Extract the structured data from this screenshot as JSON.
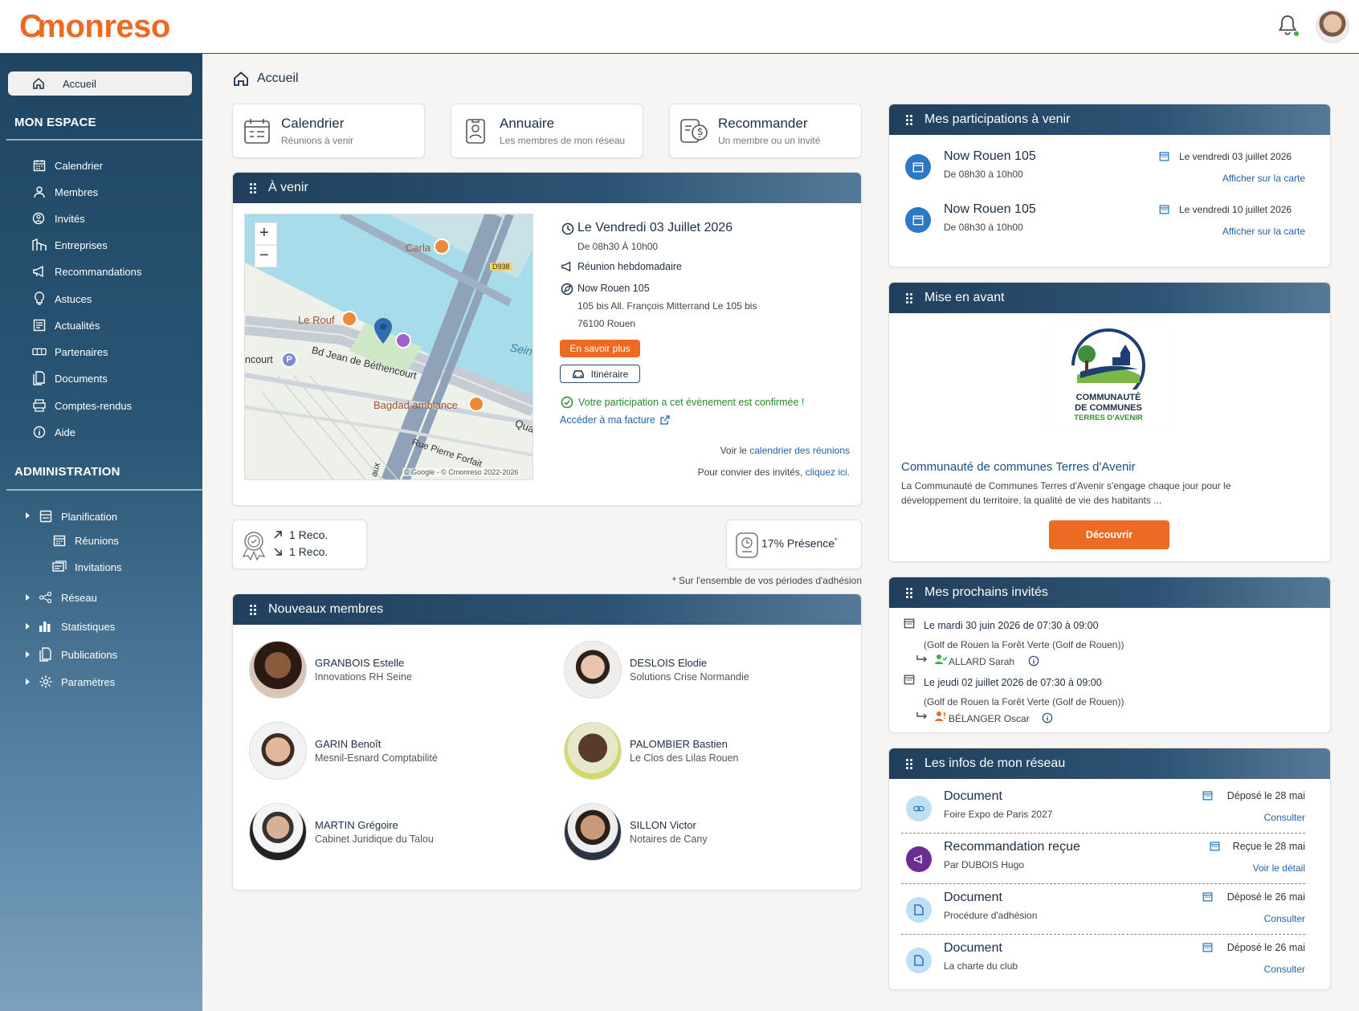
{
  "app": {
    "logo_part1": "C",
    "logo_part2": "monreso"
  },
  "sidebar": {
    "home": "Accueil",
    "section1": "MON ESPACE",
    "items": [
      {
        "label": "Calendrier",
        "icon": "calendar-icon"
      },
      {
        "label": "Membres",
        "icon": "members-icon"
      },
      {
        "label": "Invités",
        "icon": "guests-icon"
      },
      {
        "label": "Entreprises",
        "icon": "companies-icon"
      },
      {
        "label": "Recommandations",
        "icon": "megaphone-icon"
      },
      {
        "label": "Astuces",
        "icon": "lightbulb-icon"
      },
      {
        "label": "Actualités",
        "icon": "news-icon"
      },
      {
        "label": "Partenaires",
        "icon": "handshake-icon"
      },
      {
        "label": "Documents",
        "icon": "documents-icon"
      },
      {
        "label": "Comptes-rendus",
        "icon": "reports-icon"
      },
      {
        "label": "Aide",
        "icon": "info-icon"
      }
    ],
    "section2": "ADMINISTRATION",
    "admin": {
      "planification": "Planification",
      "reunions": "Réunions",
      "invitations": "Invitations",
      "reseau": "Réseau",
      "statistiques": "Statistiques",
      "publications": "Publications",
      "parametres": "Paramètres"
    }
  },
  "breadcrumb": "Accueil",
  "quick": [
    {
      "title": "Calendrier",
      "sub": "Réunions à venir"
    },
    {
      "title": "Annuaire",
      "sub": "Les membres de mon réseau"
    },
    {
      "title": "Recommander",
      "sub": "Un membre ou un invité"
    }
  ],
  "avenir": {
    "title": "À venir",
    "date": "Le Vendredi 03 Juillet 2026",
    "time": "De 08h30 À 10h00",
    "type": "Réunion hebdomadaire",
    "place": "Now Rouen 105",
    "address1": "105 bis All. François Mitterrand Le 105 bis",
    "address2": "76100 Rouen",
    "btn_more": "En savoir plus",
    "btn_route": "Itinéraire",
    "confirmed": "Votre participation a cet évènement est confirmée !",
    "invoice": "Accéder à ma facture",
    "see_prefix": "Voir le ",
    "see_link": "calendrier des réunions",
    "invite_prefix": "Pour convier des invités, ",
    "invite_link": "cliquez ici.",
    "map": {
      "zoom_in": "+",
      "zoom_out": "−",
      "labels": [
        "Carla",
        "Le Rouf",
        "Bd Jean de Béthencourt",
        "ncourt",
        "Bagdad ambiance",
        "Rue Pierre Forfait",
        "Sein",
        "Qua",
        "D938",
        "aux",
        "© Google - © Cmonreso 2022-2026"
      ]
    }
  },
  "stats": {
    "reco_out": "1 Reco.",
    "reco_in": "1 Reco.",
    "presence": "17% Présence",
    "presence_star": "*",
    "note": "* Sur l'ensemble de vos périodes d'adhésion"
  },
  "new_members": {
    "title": "Nouveaux membres",
    "list": [
      {
        "name": "GRANBOIS Estelle",
        "company": "Innovations RH Seine"
      },
      {
        "name": "DESLOIS Elodie",
        "company": "Solutions Crise Normandie"
      },
      {
        "name": "GARIN Benoît",
        "company": "Mesnil-Esnard Comptabilité"
      },
      {
        "name": "PALOMBIER Bastien",
        "company": "Le Clos des Lilas Rouen"
      },
      {
        "name": "MARTIN Grégoire",
        "company": "Cabinet Juridique du Talou"
      },
      {
        "name": "SILLON Victor",
        "company": "Notaires de Cany"
      }
    ]
  },
  "participations": {
    "title": "Mes participations à venir",
    "items": [
      {
        "title": "Now Rouen 105",
        "time": "De 08h30 à 10h00",
        "date": "Le vendredi 03 juillet 2026",
        "link": "Afficher sur la carte"
      },
      {
        "title": "Now Rouen 105",
        "time": "De 08h30 à 10h00",
        "date": "Le vendredi 10 juillet 2026",
        "link": "Afficher sur la carte"
      }
    ]
  },
  "featured": {
    "title": "Mise en avant",
    "logo_line1": "COMMUNAUTÉ",
    "logo_line2": "DE COMMUNES",
    "logo_line3": "TERRES D'AVENIR",
    "name": "Communauté de communes Terres d'Avenir",
    "desc": "La Communauté de Communes Terres d'Avenir s'engage chaque jour pour le développement du territoire, la qualité de vie des habitants ...",
    "button": "Découvrir"
  },
  "guests": {
    "title": "Mes prochains invités",
    "items": [
      {
        "when": "Le mardi 30 juin 2026 de 07:30 à 09:00",
        "where": "(Golf de Rouen la Forêt Verte (Golf de Rouen))",
        "who": "ALLARD Sarah",
        "status_color": "#3cb043"
      },
      {
        "when": "Le jeudi 02 juillet 2026 de 07:30 à 09:00",
        "where": "(Golf de Rouen la Forêt Verte (Golf de Rouen))",
        "who": "BÉLANGER Oscar",
        "status_color": "#ec6a22"
      }
    ]
  },
  "network": {
    "title": "Les infos de mon réseau",
    "items": [
      {
        "title": "Document",
        "sub": "Foire Expo de Paris 2027",
        "date": "Déposé le 28 mai",
        "link": "Consulter",
        "icon": "link-icon"
      },
      {
        "title": "Recommandation reçue",
        "sub": "Par DUBOIS Hugo",
        "date": "Reçue le 28 mai",
        "link": "Voir le détail",
        "icon": "megaphone-icon"
      },
      {
        "title": "Document",
        "sub": "Procédure d'adhésion",
        "date": "Déposé le 26 mai",
        "link": "Consulter",
        "icon": "document-icon"
      },
      {
        "title": "Document",
        "sub": "La charte du club",
        "date": "Déposé le 26 mai",
        "link": "Consulter",
        "icon": "document-icon"
      }
    ]
  },
  "colors": {
    "accent": "#ec6a22",
    "navy": "#1d2e44",
    "header": "#2d5374",
    "link": "#2463a6",
    "success": "#2a8a2a"
  }
}
